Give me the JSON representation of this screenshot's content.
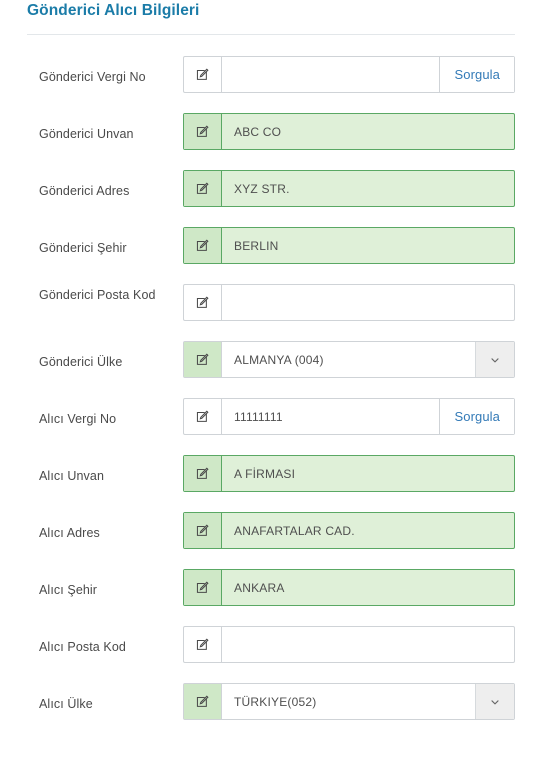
{
  "panel": {
    "title": "Gönderici Alıcı Bilgileri"
  },
  "icons": {
    "edit": "pencil-square-icon",
    "chevron": "chevron-down-icon"
  },
  "labels": {
    "sorgula": "Sorgula"
  },
  "colors": {
    "title": "#1b7ca8",
    "filled_bg": "#dff0d8",
    "filled_border": "#5aa864",
    "addon_green": "#cfe8c7",
    "link": "#337ab7",
    "border": "#cfd3d7",
    "chevron_bg": "#eeeeee",
    "text": "#4f4f4f"
  },
  "rows": [
    {
      "label": "Gönderici Vergi No",
      "value": "",
      "placeholder": "",
      "filled": false,
      "type": "text-with-action",
      "action_label": "Sorgula",
      "label_lines": 1
    },
    {
      "label": "Gönderici Unvan",
      "value": "ABC CO",
      "placeholder": "",
      "filled": true,
      "type": "text",
      "label_lines": 1
    },
    {
      "label": "Gönderici Adres",
      "value": "XYZ STR.",
      "placeholder": "",
      "filled": true,
      "type": "text",
      "label_lines": 1
    },
    {
      "label": "Gönderici Şehir",
      "value": "BERLIN",
      "placeholder": "",
      "filled": true,
      "type": "text",
      "label_lines": 1
    },
    {
      "label": "Gönderici Posta Kod",
      "value": "",
      "placeholder": "",
      "filled": false,
      "type": "text",
      "label_lines": 2
    },
    {
      "label": "Gönderici Ülke",
      "value": "ALMANYA (004)",
      "placeholder": "",
      "filled": false,
      "type": "select",
      "label_lines": 1
    },
    {
      "label": "Alıcı Vergi No",
      "value": "11111111",
      "placeholder": "",
      "filled": false,
      "type": "text-with-action",
      "action_label": "Sorgula",
      "label_lines": 1
    },
    {
      "label": "Alıcı Unvan",
      "value": "A FİRMASI",
      "placeholder": "",
      "filled": true,
      "type": "text",
      "label_lines": 1
    },
    {
      "label": "Alıcı Adres",
      "value": "ANAFARTALAR CAD.",
      "placeholder": "",
      "filled": true,
      "type": "text",
      "label_lines": 1
    },
    {
      "label": "Alıcı Şehir",
      "value": "ANKARA",
      "placeholder": "",
      "filled": true,
      "type": "text",
      "label_lines": 1
    },
    {
      "label": "Alıcı Posta Kod",
      "value": "",
      "placeholder": "",
      "filled": false,
      "type": "text",
      "label_lines": 1
    },
    {
      "label": "Alıcı Ülke",
      "value": "TÜRKIYE(052)",
      "placeholder": "",
      "filled": false,
      "type": "select",
      "label_lines": 1
    }
  ]
}
